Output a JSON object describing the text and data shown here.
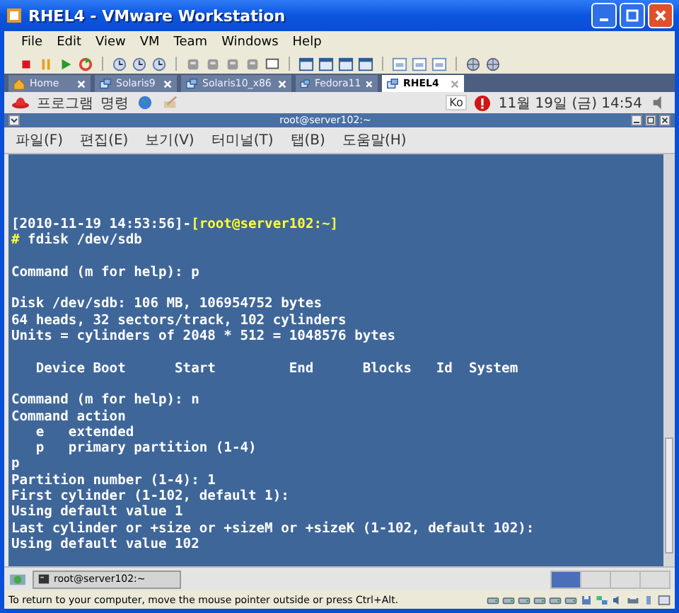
{
  "window": {
    "title": "RHEL4 - VMware Workstation"
  },
  "menu": [
    "File",
    "Edit",
    "View",
    "VM",
    "Team",
    "Windows",
    "Help"
  ],
  "tabs": [
    {
      "label": "Home",
      "selected": false,
      "kind": "home"
    },
    {
      "label": "Solaris9",
      "selected": false,
      "kind": "vm"
    },
    {
      "label": "Solaris10_x86",
      "selected": false,
      "kind": "vm"
    },
    {
      "label": "Fedora11",
      "selected": false,
      "kind": "vm"
    },
    {
      "label": "RHEL4",
      "selected": true,
      "kind": "vm"
    }
  ],
  "guest_panel": {
    "menus": [
      "프로그램",
      "명령"
    ],
    "input_method": "Ko",
    "clock": "11월 19일 (금) 14:54"
  },
  "terminal": {
    "title": "root@server102:~",
    "menu": [
      "파일(F)",
      "편집(E)",
      "보기(V)",
      "터미널(T)",
      "탭(B)",
      "도움말(H)"
    ],
    "lines": [
      {
        "kind": "prompt",
        "timestamp": "[2010-11-19 14:53:56]-",
        "user_host": "[root@server102:~]"
      },
      {
        "kind": "command",
        "symbol": "#",
        "text": " fdisk /dev/sdb"
      },
      {
        "kind": "blank"
      },
      {
        "kind": "output",
        "text": "Command (m for help): p"
      },
      {
        "kind": "blank"
      },
      {
        "kind": "output",
        "text": "Disk /dev/sdb: 106 MB, 106954752 bytes"
      },
      {
        "kind": "output",
        "text": "64 heads, 32 sectors/track, 102 cylinders"
      },
      {
        "kind": "output",
        "text": "Units = cylinders of 2048 * 512 = 1048576 bytes"
      },
      {
        "kind": "blank"
      },
      {
        "kind": "output",
        "text": "   Device Boot      Start         End      Blocks   Id  System"
      },
      {
        "kind": "blank"
      },
      {
        "kind": "output",
        "text": "Command (m for help): n"
      },
      {
        "kind": "output",
        "text": "Command action"
      },
      {
        "kind": "output",
        "text": "   e   extended"
      },
      {
        "kind": "output",
        "text": "   p   primary partition (1-4)"
      },
      {
        "kind": "output",
        "text": "p"
      },
      {
        "kind": "output",
        "text": "Partition number (1-4): 1"
      },
      {
        "kind": "output",
        "text": "First cylinder (1-102, default 1):"
      },
      {
        "kind": "output",
        "text": "Using default value 1"
      },
      {
        "kind": "output",
        "text": "Last cylinder or +size or +sizeM or +sizeK (1-102, default 102):"
      },
      {
        "kind": "output",
        "text": "Using default value 102"
      }
    ]
  },
  "guest_taskbar": {
    "task": "root@server102:~"
  },
  "status_bar": "To return to your computer, move the mouse pointer outside or press Ctrl+Alt."
}
